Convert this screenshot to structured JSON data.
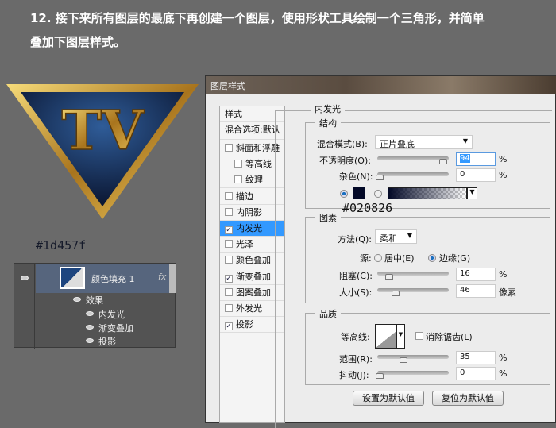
{
  "intro": {
    "line1": "12. 接下来所有图层的最底下再创建一个图层，使用形状工具绘制一个三角形，并简单",
    "line2": "叠加下图层样式。"
  },
  "logo": {
    "text": "TV"
  },
  "annotations": {
    "fill_color": "#1d457f",
    "glow_color": "#020826"
  },
  "layers": {
    "layer_name": "颜色填充 1",
    "fx": "fx",
    "effects_label": "效果",
    "effects": [
      "内发光",
      "渐变叠加",
      "投影"
    ]
  },
  "dialog": {
    "title": "图层样式",
    "styles_header": "样式",
    "blend_options": "混合选项:默认",
    "styles": [
      {
        "label": "斜面和浮雕",
        "checked": false
      },
      {
        "label": "等高线",
        "checked": false
      },
      {
        "label": "纹理",
        "checked": false
      },
      {
        "label": "描边",
        "checked": false
      },
      {
        "label": "内阴影",
        "checked": false
      },
      {
        "label": "内发光",
        "checked": true,
        "selected": true
      },
      {
        "label": "光泽",
        "checked": false
      },
      {
        "label": "颜色叠加",
        "checked": false
      },
      {
        "label": "渐变叠加",
        "checked": true
      },
      {
        "label": "图案叠加",
        "checked": false
      },
      {
        "label": "外发光",
        "checked": false
      },
      {
        "label": "投影",
        "checked": true
      }
    ],
    "panel_title": "内发光",
    "structure": {
      "title": "结构",
      "blend_mode_label": "混合模式(B):",
      "blend_mode": "正片叠底",
      "opacity_label": "不透明度(O):",
      "opacity": "94",
      "noise_label": "杂色(N):",
      "noise": "0",
      "pct": "%",
      "color": "#020826"
    },
    "elements": {
      "title": "图素",
      "method_label": "方法(Q):",
      "method": "柔和",
      "source_label": "源:",
      "center": "居中(E)",
      "edge": "边缘(G)",
      "choke_label": "阻塞(C):",
      "choke": "16",
      "size_label": "大小(S):",
      "size": "46",
      "px": "像素"
    },
    "quality": {
      "title": "品质",
      "contour_label": "等高线:",
      "antialias": "消除锯齿(L)",
      "range_label": "范围(R):",
      "range": "35",
      "jitter_label": "抖动(J):",
      "jitter": "0"
    },
    "buttons": {
      "set_default": "设置为默认值",
      "reset_default": "复位为默认值"
    }
  }
}
